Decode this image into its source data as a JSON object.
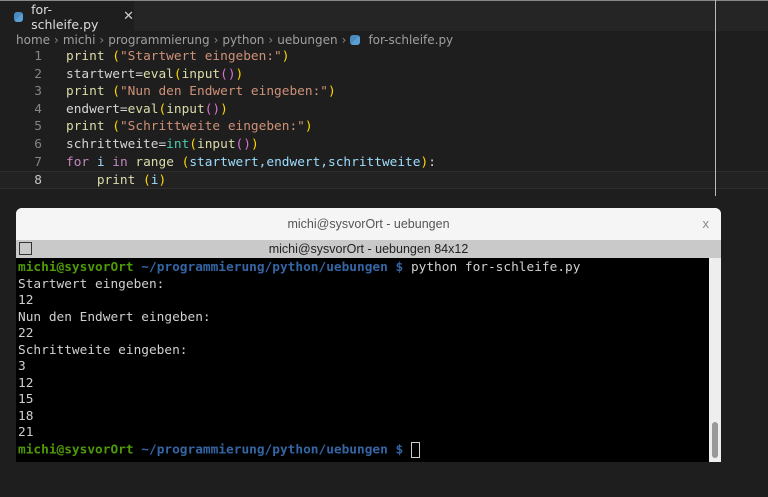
{
  "editor": {
    "tab": {
      "label": "for-schleife.py",
      "close": "✕"
    },
    "breadcrumb": [
      "home",
      "michi",
      "programmierung",
      "python",
      "uebungen",
      "for-schleife.py"
    ],
    "lines": [
      {
        "n": "1",
        "parts": [
          [
            "print ",
            "#dcdcaa"
          ],
          [
            "(",
            "#ffd700"
          ],
          [
            "\"Startwert eingeben:\"",
            "#ce9178"
          ],
          [
            ")",
            "#ffd700"
          ]
        ]
      },
      {
        "n": "2",
        "parts": [
          [
            "startwert=",
            "#d4d4d4"
          ],
          [
            "eval",
            "#dcdcaa"
          ],
          [
            "(",
            "#ffd700"
          ],
          [
            "input",
            "#dcdcaa"
          ],
          [
            "()",
            "#da70d6"
          ],
          [
            ")",
            "#ffd700"
          ]
        ]
      },
      {
        "n": "3",
        "parts": [
          [
            "print ",
            "#dcdcaa"
          ],
          [
            "(",
            "#ffd700"
          ],
          [
            "\"Nun den Endwert eingeben:\"",
            "#ce9178"
          ],
          [
            ")",
            "#ffd700"
          ]
        ]
      },
      {
        "n": "4",
        "parts": [
          [
            "endwert=",
            "#d4d4d4"
          ],
          [
            "eval",
            "#dcdcaa"
          ],
          [
            "(",
            "#ffd700"
          ],
          [
            "input",
            "#dcdcaa"
          ],
          [
            "()",
            "#da70d6"
          ],
          [
            ")",
            "#ffd700"
          ]
        ]
      },
      {
        "n": "5",
        "parts": [
          [
            "print ",
            "#dcdcaa"
          ],
          [
            "(",
            "#ffd700"
          ],
          [
            "\"Schrittweite eingeben:\"",
            "#ce9178"
          ],
          [
            ")",
            "#ffd700"
          ]
        ]
      },
      {
        "n": "6",
        "parts": [
          [
            "schrittweite=",
            "#d4d4d4"
          ],
          [
            "int",
            "#4ec9b0"
          ],
          [
            "(",
            "#ffd700"
          ],
          [
            "input",
            "#dcdcaa"
          ],
          [
            "()",
            "#da70d6"
          ],
          [
            ")",
            "#ffd700"
          ]
        ]
      },
      {
        "n": "7",
        "parts": [
          [
            "for ",
            "#c586c0"
          ],
          [
            "i ",
            "#9cdcfe"
          ],
          [
            "in ",
            "#c586c0"
          ],
          [
            "range ",
            "#dcdcaa"
          ],
          [
            "(",
            "#ffd700"
          ],
          [
            "startwert,endwert,schrittweite",
            "#9cdcfe"
          ],
          [
            ")",
            "#ffd700"
          ],
          [
            ":",
            "#d4d4d4"
          ]
        ]
      },
      {
        "n": "8",
        "parts": [
          [
            "    print ",
            "#dcdcaa"
          ],
          [
            "(",
            "#ffd700"
          ],
          [
            "i",
            "#9cdcfe"
          ],
          [
            ")",
            "#ffd700"
          ]
        ]
      }
    ]
  },
  "terminal": {
    "title": "michi@sysvorOrt - uebungen",
    "close": "x",
    "subtitle": "michi@sysvorOrt - uebungen 84x12",
    "prompt_user": "michi@sysvorOrt",
    "prompt_path": " ~/programmierung/python/uebungen $",
    "command": " python for-schleife.py",
    "output": [
      "Startwert eingeben:",
      "12",
      "Nun den Endwert eingeben:",
      "22",
      "Schrittweite eingeben:",
      "3",
      "12",
      "15",
      "18",
      "21"
    ]
  }
}
